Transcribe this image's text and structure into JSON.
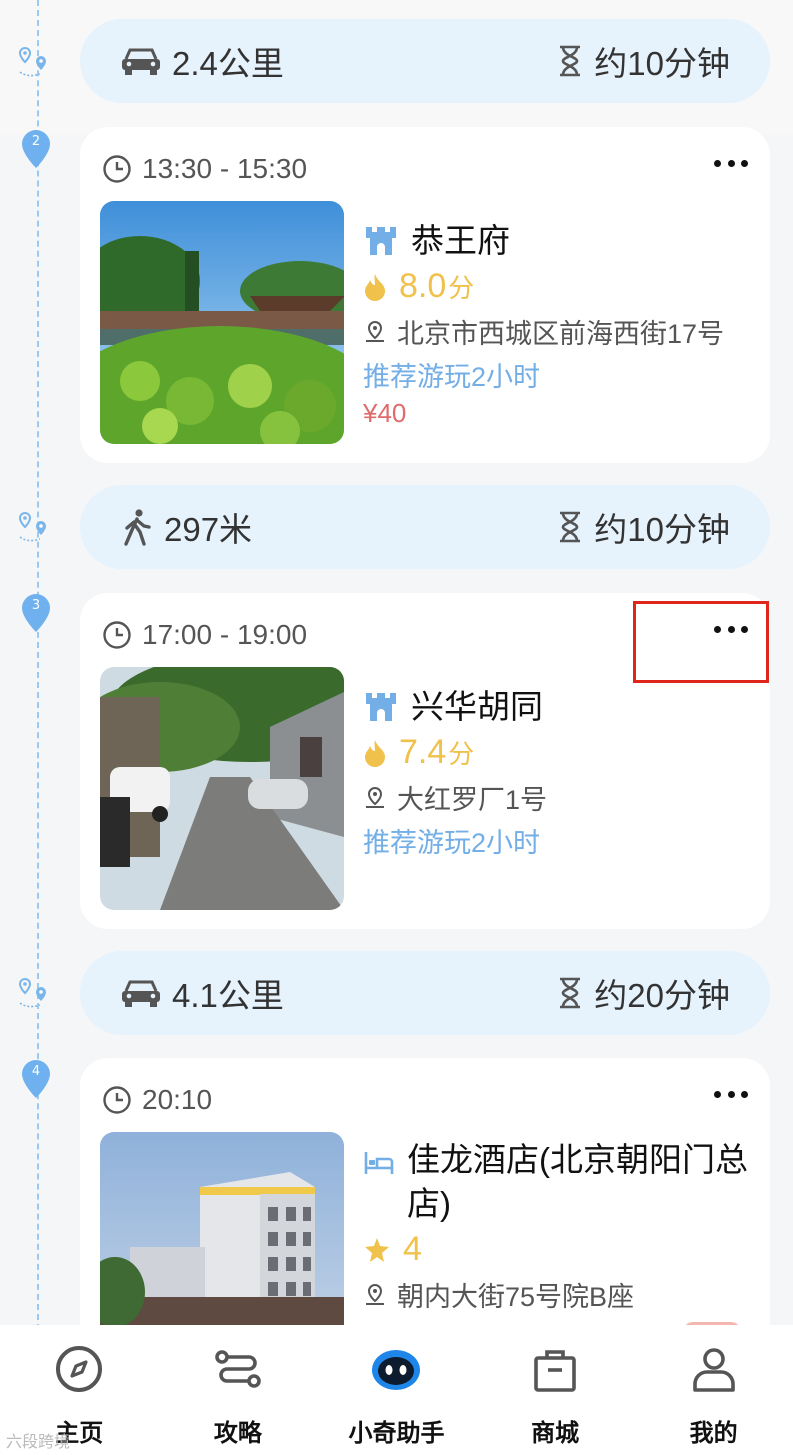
{
  "route_segments": [
    {
      "mode_icon": "car-icon",
      "distance": "2.4公里",
      "duration": "约10分钟"
    },
    {
      "mode_icon": "walk-icon",
      "distance": "297米",
      "duration": "约10分钟"
    },
    {
      "mode_icon": "car-icon",
      "distance": "4.1公里",
      "duration": "约20分钟"
    }
  ],
  "stops": [
    {
      "index": "2",
      "time": "13:30 - 15:30",
      "type_icon": "castle-icon",
      "name": "恭王府",
      "rating_icon": "flame-icon",
      "score": "8.0",
      "score_unit": "分",
      "address": "北京市西城区前海西街17号",
      "recommend": "推荐游玩2小时",
      "price": "¥40"
    },
    {
      "index": "3",
      "time": "17:00 - 19:00",
      "type_icon": "castle-icon",
      "name": "兴华胡同",
      "rating_icon": "flame-icon",
      "score": "7.4",
      "score_unit": "分",
      "address": "大红罗厂1号",
      "recommend": "推荐游玩2小时"
    },
    {
      "index": "4",
      "time": "20:10",
      "type_icon": "bed-icon",
      "name": "佳龙酒店(北京朝阳门总店)",
      "rating_icon": "star-icon",
      "score": "4",
      "address": "朝内大街75号院B座"
    }
  ],
  "tabbar": [
    {
      "label": "主页",
      "icon": "compass-icon"
    },
    {
      "label": "攻略",
      "icon": "route-guide-icon"
    },
    {
      "label": "小奇助手",
      "icon": "robot-icon"
    },
    {
      "label": "商城",
      "icon": "shopping-bag-icon"
    },
    {
      "label": "我的",
      "icon": "user-icon"
    }
  ],
  "watermark": "六段跨境",
  "colors": {
    "accent_blue": "#73aee6",
    "transport_bg": "#e6f2fc",
    "score_yellow": "#f0c14b",
    "price_red": "#e06b6b",
    "highlight_red": "#e0261b"
  }
}
